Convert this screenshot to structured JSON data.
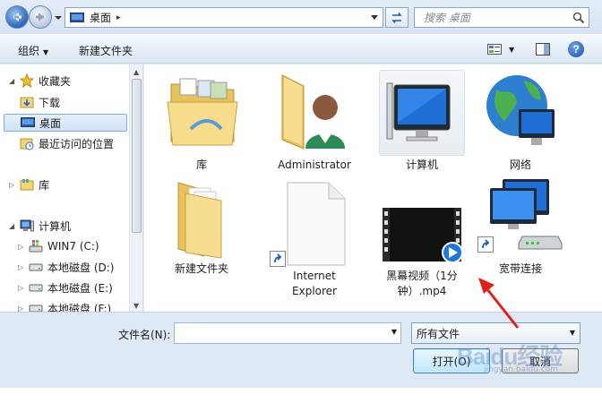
{
  "address": {
    "location": "桌面",
    "separator": "▸",
    "search_placeholder": "搜索 桌面"
  },
  "toolbar": {
    "organize": "组织",
    "new_folder": "新建文件夹"
  },
  "nav": {
    "items": [
      {
        "label": "收藏夹",
        "icon": "star-icon"
      },
      {
        "label": "下载",
        "icon": "downloads-folder-icon"
      },
      {
        "label": "桌面",
        "icon": "desktop-icon",
        "selected": true
      },
      {
        "label": "最近访问的位置",
        "icon": "recent-places-icon"
      },
      {
        "label": "库",
        "icon": "library-icon"
      },
      {
        "label": "计算机",
        "icon": "computer-icon"
      },
      {
        "label": "WIN7 (C:)",
        "icon": "windows-drive-icon"
      },
      {
        "label": "本地磁盘 (D:)",
        "icon": "drive-icon"
      },
      {
        "label": "本地磁盘 (E:)",
        "icon": "drive-icon"
      },
      {
        "label": "本地磁盘 (F:)",
        "icon": "drive-icon"
      }
    ]
  },
  "content": {
    "items": [
      {
        "label": "库",
        "icon": "library-folder-icon"
      },
      {
        "label": "Administrator",
        "icon": "user-folder-icon"
      },
      {
        "label": "计算机",
        "icon": "computer-icon",
        "selected": true
      },
      {
        "label": "网络",
        "icon": "network-globe-icon"
      },
      {
        "label": "新建文件夹",
        "icon": "folder-icon"
      },
      {
        "label_line1": "Internet",
        "label_line2": "Explorer",
        "icon": "shortcut-file-icon"
      },
      {
        "label_line1": "黑幕视频（1分",
        "label_line2": "钟）.mp4",
        "icon": "video-file-icon"
      },
      {
        "label": "宽带连接",
        "icon": "broadband-connection-icon"
      }
    ]
  },
  "bottom": {
    "filename_label": "文件名(N):",
    "filename_value": "",
    "filetype": "所有文件",
    "open_button": "打开(O)",
    "cancel_button": "取消"
  },
  "watermark": {
    "text": "Baidu经验",
    "sub": "jingyan.baidu.com"
  }
}
